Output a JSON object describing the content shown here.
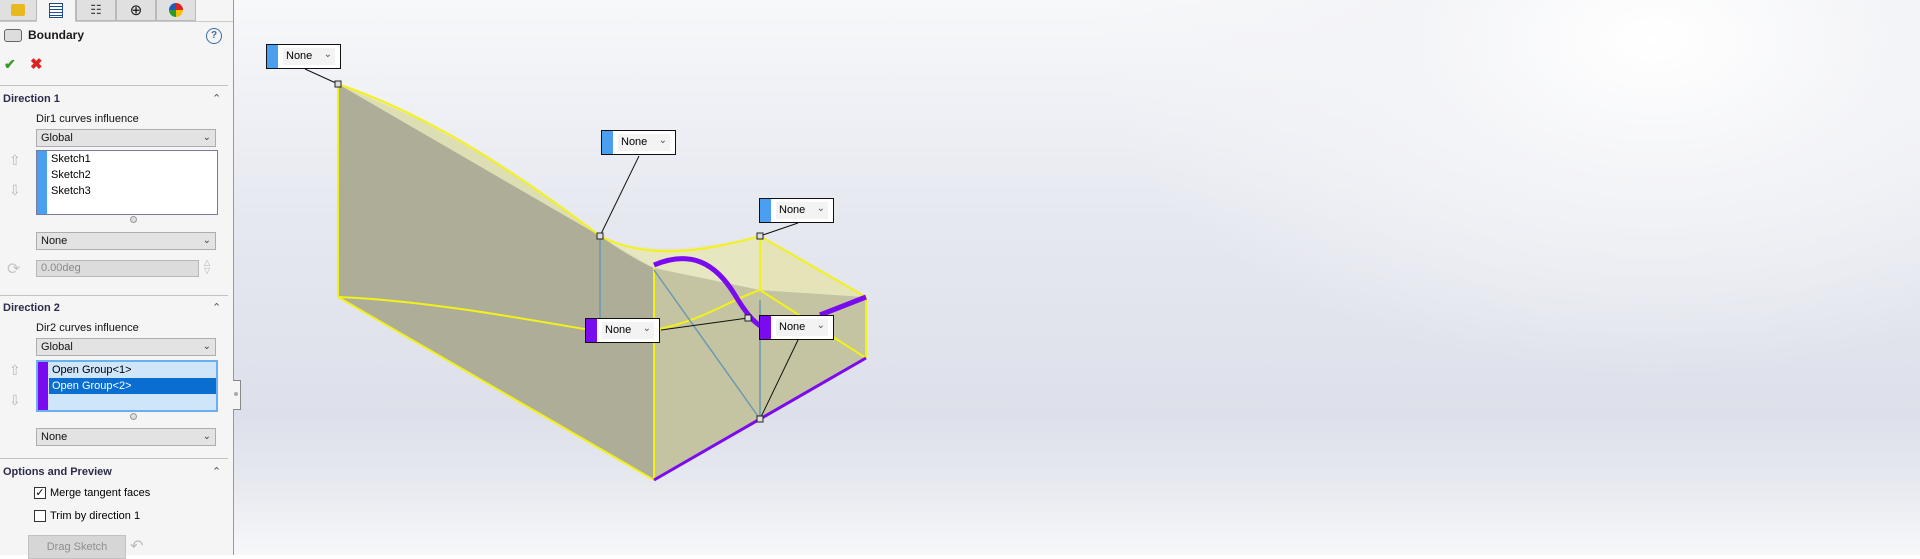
{
  "tabs": [
    {
      "icon": "feature-manager-icon",
      "active": false
    },
    {
      "icon": "property-manager-icon",
      "active": true
    },
    {
      "icon": "configuration-manager-icon",
      "active": false
    },
    {
      "icon": "dimxpert-icon",
      "active": false
    },
    {
      "icon": "display-manager-icon",
      "active": false
    }
  ],
  "property_manager": {
    "title": "Boundary",
    "help_label": "?",
    "ok_label": "✔",
    "cancel_label": "✖"
  },
  "direction1": {
    "header": "Direction 1",
    "influence_label": "Dir1 curves influence",
    "influence_value": "Global",
    "curves": [
      "Sketch1",
      "Sketch2",
      "Sketch3"
    ],
    "color": "#4a9ff0",
    "tangency_value": "None",
    "angle_value": "0.00deg"
  },
  "direction2": {
    "header": "Direction 2",
    "influence_label": "Dir2 curves influence",
    "influence_value": "Global",
    "curves": [
      "Open Group<1>",
      "Open Group<2>"
    ],
    "selected_index": 1,
    "color": "#7a0af0",
    "tangency_value": "None"
  },
  "options": {
    "header": "Options and Preview",
    "merge_tangent_faces": {
      "label": "Merge tangent faces",
      "checked": true
    },
    "trim_by_direction1": {
      "label": "Trim by direction 1",
      "checked": false
    },
    "drag_sketch_label": "Drag Sketch"
  },
  "callouts": [
    {
      "label": "None",
      "direction": 1
    },
    {
      "label": "None",
      "direction": 1
    },
    {
      "label": "None",
      "direction": 1
    },
    {
      "label": "None",
      "direction": 2
    },
    {
      "label": "None",
      "direction": 2
    }
  ],
  "colors": {
    "dir1": "#4a9ff0",
    "dir2": "#7a0af0",
    "edge_highlight": "#f2f21a",
    "face": "#b3b39a"
  }
}
